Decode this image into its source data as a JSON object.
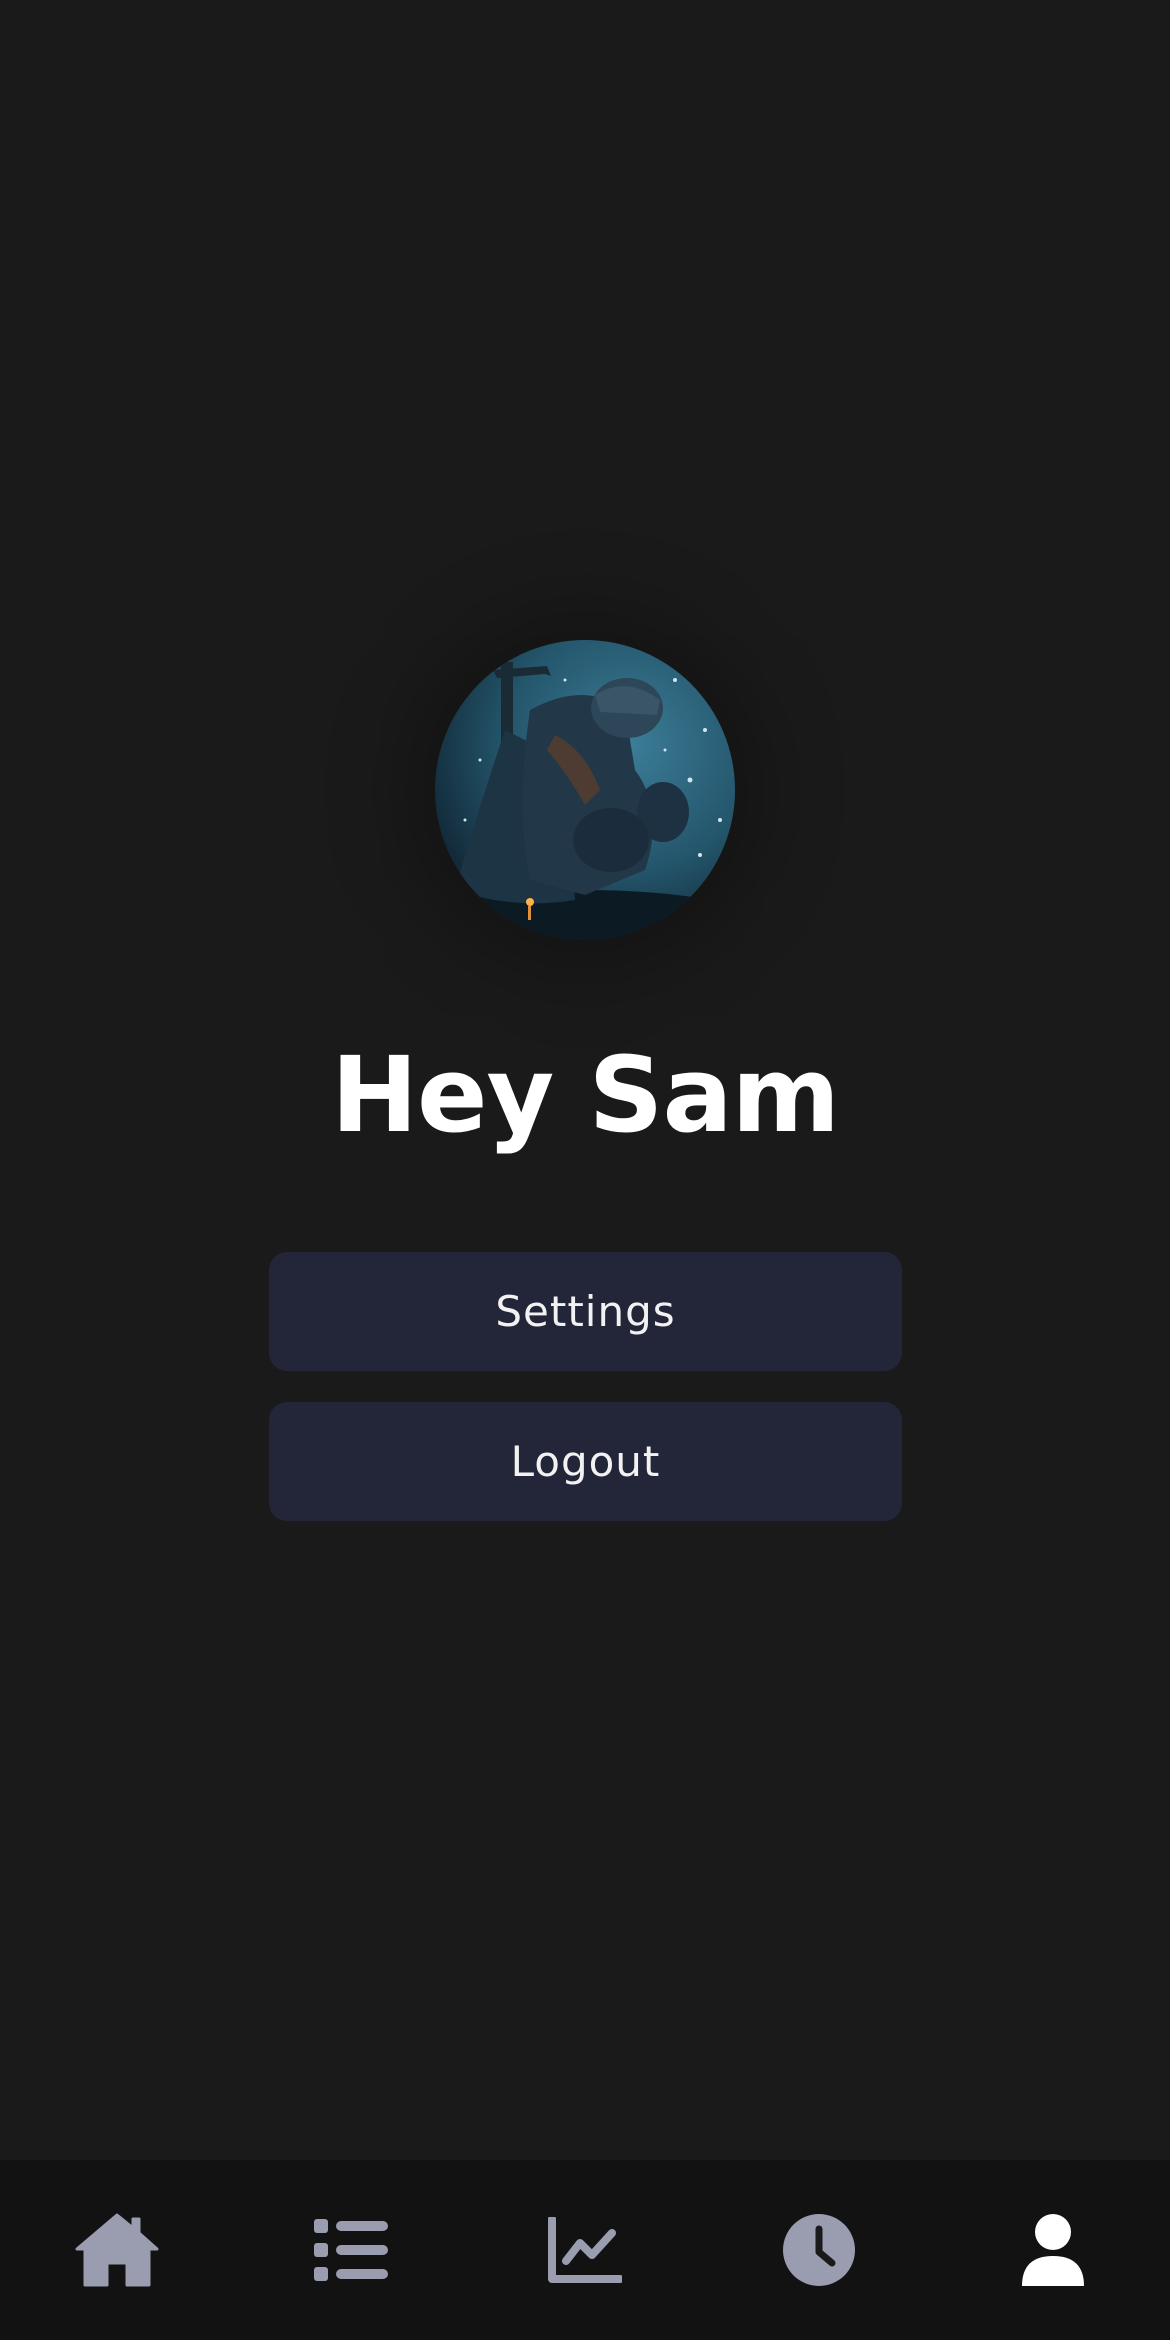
{
  "profile": {
    "greeting": "Hey Sam",
    "avatar_icon": "knight-avatar-photo"
  },
  "menu": {
    "settings_label": "Settings",
    "logout_label": "Logout"
  },
  "tabbar": {
    "items": [
      {
        "icon": "home-icon",
        "active": false
      },
      {
        "icon": "list-icon",
        "active": false
      },
      {
        "icon": "chart-line-icon",
        "active": false
      },
      {
        "icon": "clock-icon",
        "active": false
      },
      {
        "icon": "user-icon",
        "active": true
      }
    ]
  },
  "colors": {
    "background": "#1a1a1a",
    "button": "#232538",
    "tabbar": "#121212",
    "icon_inactive": "#9a9cb0",
    "icon_active": "#ffffff"
  }
}
